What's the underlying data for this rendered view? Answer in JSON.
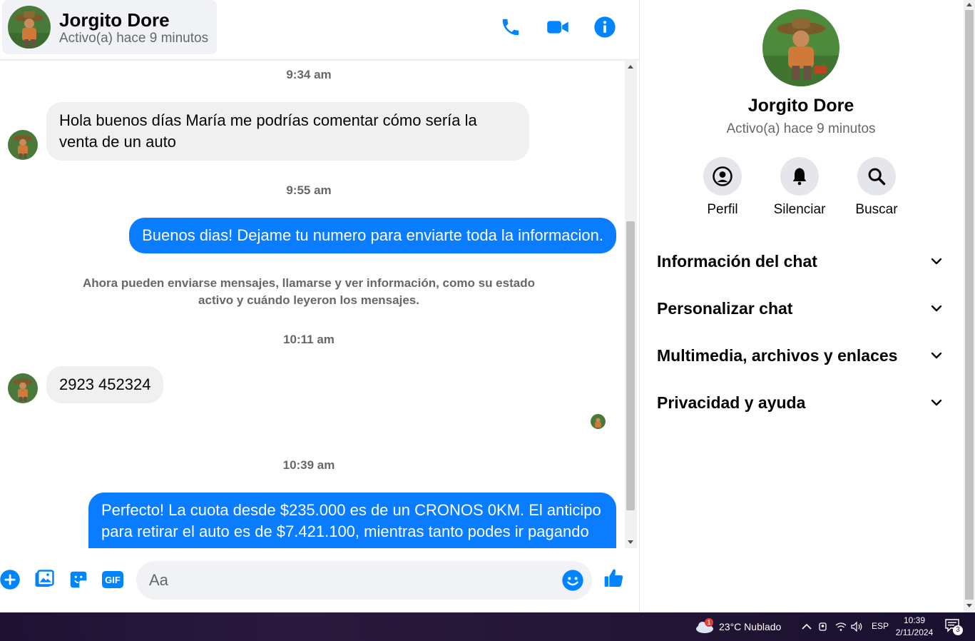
{
  "contact": {
    "name": "Jorgito Dore",
    "status": "Activo(a) hace 9 minutos"
  },
  "colors": {
    "accent": "#0a7cff",
    "icon_blue": "#0084ff",
    "incoming_bubble": "#f0f0f0",
    "taskbar": "#1d1233"
  },
  "header_actions": {
    "call_icon": "phone-icon",
    "video_icon": "video-camera-icon",
    "info_icon": "info-icon"
  },
  "messages": {
    "ts1": "9:34 am",
    "m1": "Hola buenos días María me podrías comentar cómo sería la venta de un auto",
    "ts2": "9:55 am",
    "m2": "Buenos dias! Dejame tu numero para enviarte toda la informacion.",
    "sysnote": "Ahora pueden enviarse mensajes, llamarse y ver información, como su estado activo y cuándo leyeron los mensajes.",
    "ts3": "10:11 am",
    "m3": "2923 452324",
    "ts4": "10:39 am",
    "m4": "Perfecto! La cuota desde $235.000 es de un CRONOS 0KM. El anticipo para retirar el auto es de $7.421.100, mientras tanto podes ir pagando"
  },
  "composer": {
    "placeholder": "Aa",
    "icons": [
      "plus-icon",
      "image-icon",
      "sticker-icon",
      "gif-icon",
      "emoji-icon",
      "thumbs-up-icon"
    ],
    "gif_label": "GIF"
  },
  "info_panel": {
    "name": "Jorgito Dore",
    "status": "Activo(a) hace 9 minutos",
    "actions": [
      {
        "label": "Perfil",
        "icon": "profile-icon"
      },
      {
        "label": "Silenciar",
        "icon": "bell-icon"
      },
      {
        "label": "Buscar",
        "icon": "search-icon"
      }
    ],
    "sections": [
      {
        "title": "Información del chat"
      },
      {
        "title": "Personalizar chat"
      },
      {
        "title": "Multimedia, archivos y enlaces"
      },
      {
        "title": "Privacidad y ayuda"
      }
    ]
  },
  "taskbar": {
    "weather": "23°C  Nublado",
    "weather_badge": "1",
    "language": "ESP",
    "time": "10:39",
    "date": "2/11/2024",
    "notification_count": "3"
  }
}
